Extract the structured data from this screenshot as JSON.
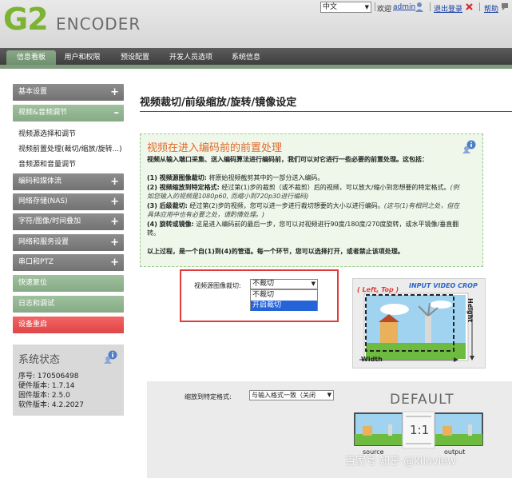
{
  "header": {
    "logo_main": "G2",
    "logo_sub": "ENCODER",
    "language": "中文",
    "welcome": "欢迎",
    "user": "admin",
    "logout": "退出登录",
    "help": "帮助"
  },
  "nav": {
    "tabs": [
      "信息看板",
      "用户和权限",
      "预设配置",
      "开发人员选项",
      "系统信息"
    ]
  },
  "sidebar": {
    "items": [
      {
        "label": "基本设置",
        "expand": "+"
      },
      {
        "label": "视频&音频调节",
        "expand": "–"
      },
      {
        "label": "编码和媒体流",
        "expand": "+"
      },
      {
        "label": "网络存储(NAS)",
        "expand": "+"
      },
      {
        "label": "字符/图像/时间叠加",
        "expand": "+"
      },
      {
        "label": "网络和服务设置",
        "expand": "+"
      },
      {
        "label": "串口和PTZ",
        "expand": "+"
      },
      {
        "label": "快速复位"
      },
      {
        "label": "日志和调试"
      },
      {
        "label": "设备重启"
      }
    ],
    "subitems": [
      "视频源选择和调节",
      "视频前置处理(裁切/缩放/旋转...)",
      "音频源和音量调节"
    ]
  },
  "status": {
    "title": "系统状态",
    "lines": [
      "序号: 170506498",
      "硬件版本: 1.7.14",
      "固件版本: 2.5.0",
      "软件版本: 4.2.2027"
    ]
  },
  "main": {
    "title": "视频裁切/前级缩放/旋转/镜像设定"
  },
  "description": {
    "title": "视频在进入编码前的前置处理",
    "intro": "视频从输入端口采集、送入编码算法进行编码前，我们可以对它进行一些必要的前置处理。这包括：",
    "step1_head": "(1) 视频源图像裁切:",
    "step1_body": "将原始视频截剪其中的一部分送入编码。",
    "step2_head": "(2) 视频缩放到特定格式:",
    "step2_body": "经过第(1)步的裁剪（或不裁剪）后的视频，可以放大/缩小到您想要的特定格式。",
    "step2_note": "(例",
    "step2_note2": "如您输入的视频是1080p60, 而缩小到720p30进行编码)",
    "step3_head": "(3) 后级裁切:",
    "step3_body": "经过第(2)步的视频，您可以进一步进行裁切想要的大小以进行编码。",
    "step3_note": "(这与(1)有相同之处，但在",
    "step3_note2": "具体应用中也有必要之处，请酌情处理。)",
    "step4_head": "(4) 旋转或镜像:",
    "step4_body": "这是进入编码前的最后一步，您可以对视频进行90度/180度/270度旋转，或水平镜像/垂直翻",
    "step4_body2": "转。",
    "summary": "以上过程，是一个自(1)到(4)的管道。每一个环节，您可以选择打开，或者禁止该项处理。"
  },
  "crop": {
    "label": "视频源图像裁切:",
    "selected": "不裁切",
    "options": [
      "不裁切",
      "开启裁切"
    ]
  },
  "crop_diagram": {
    "title": "INPUT VIDEO CROP",
    "corner": "( Left, Top )",
    "height": "Height",
    "width": "Width"
  },
  "scale": {
    "label": "缩放到特定格式:",
    "selected": "与输入格式一致（关闭",
    "banner": "DEFAULT",
    "ratio": "1:1",
    "source": "source",
    "output": "output"
  },
  "watermark": "百家号 知乎 @kiloview",
  "colors": {
    "accent_green": "#7cb332",
    "title_orange": "#e46a2a",
    "highlight_red": "#e23b3b",
    "selected_blue": "#2563d8"
  }
}
